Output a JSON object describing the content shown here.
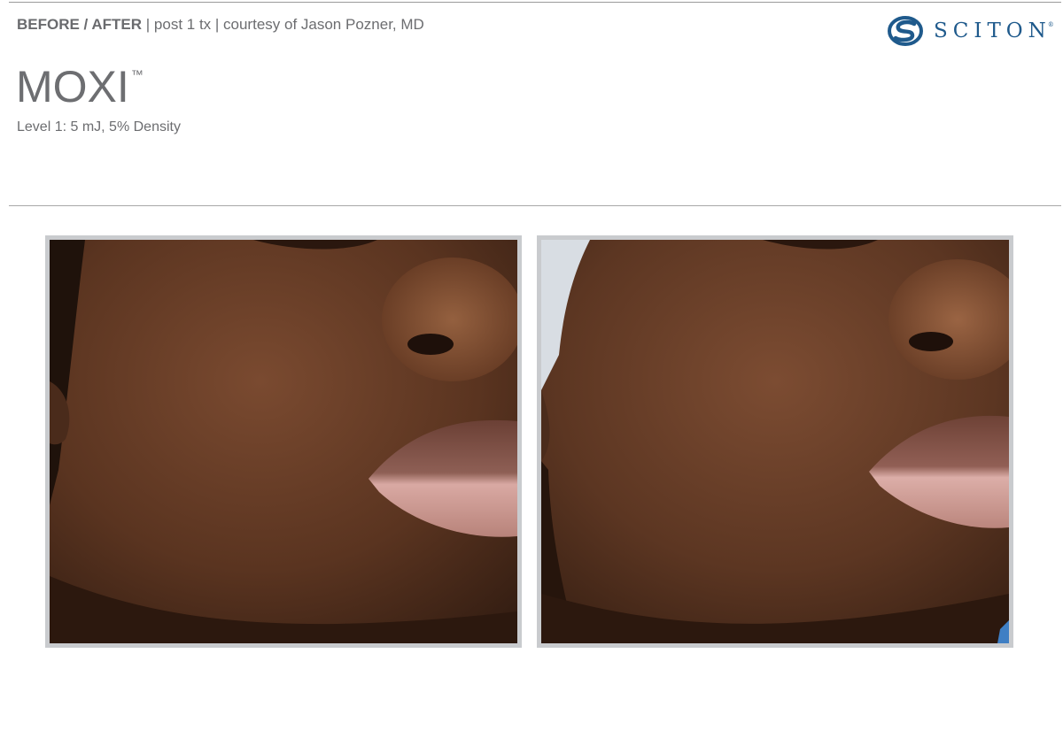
{
  "header": {
    "label_bold": "BEFORE / AFTER",
    "label_rest": " | post 1 tx | courtesy of Jason Pozner, MD"
  },
  "title": {
    "text": "MOXI",
    "mark": "™"
  },
  "subtitle": "Level 1: 5 mJ, 5% Density",
  "logo": {
    "text": "SCITON",
    "mark": "®",
    "color": "#1f5a8c",
    "icon": "sciton-s-logo-icon"
  },
  "photos": {
    "before_alt": "before-treatment-photo",
    "after_alt": "after-treatment-photo"
  },
  "colors": {
    "text_gray": "#6c6d70",
    "frame_gray": "#c9cbce",
    "rule_gray": "#a8a8a8"
  }
}
